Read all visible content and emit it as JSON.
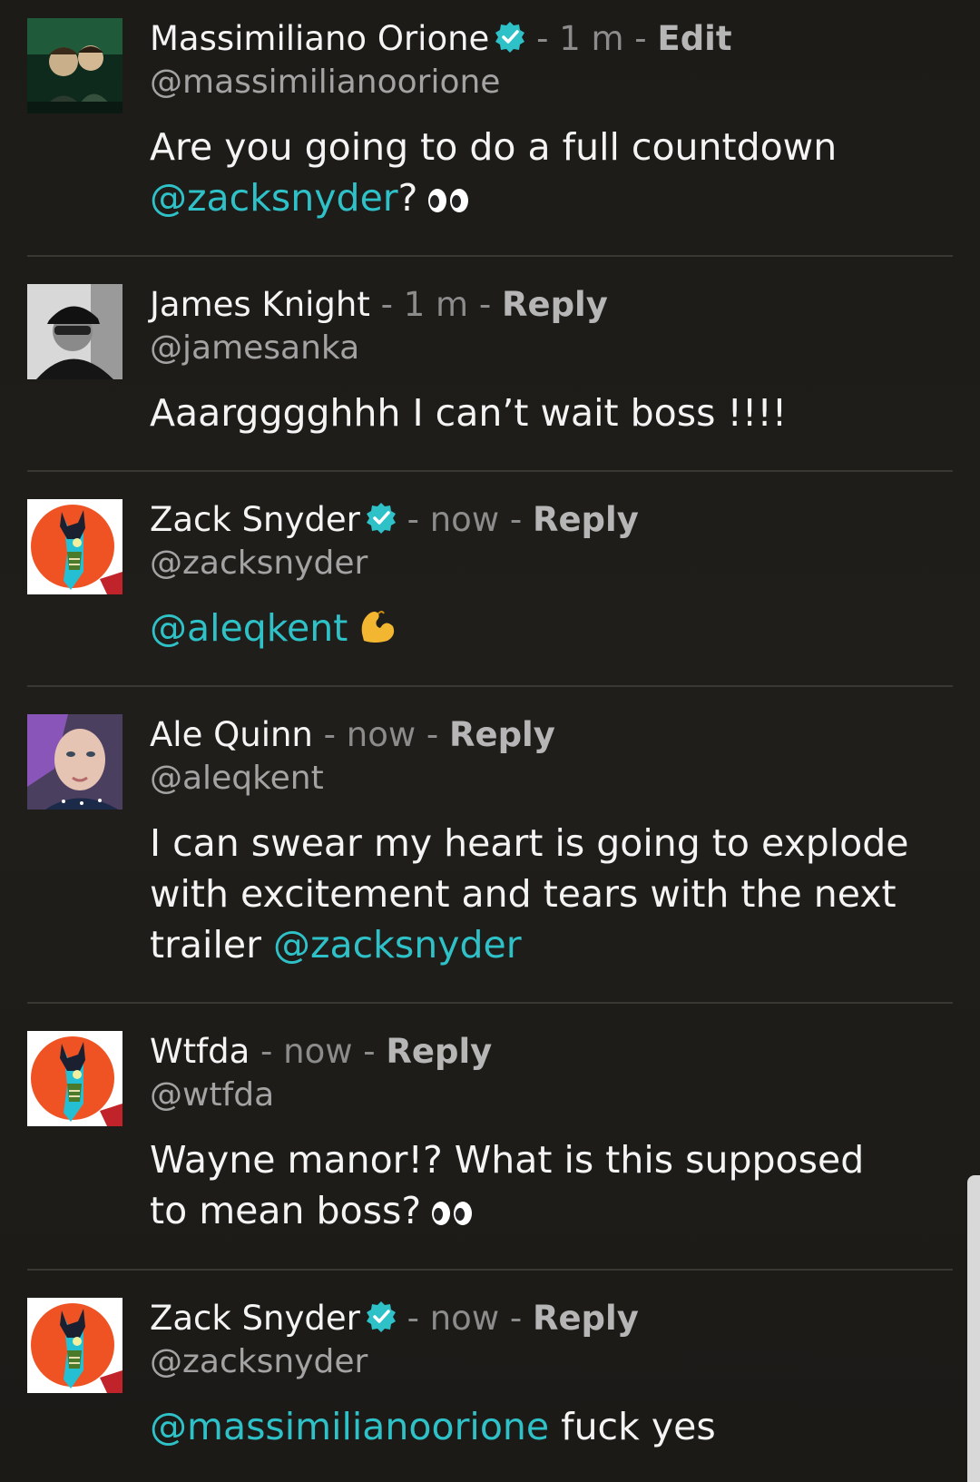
{
  "comments": [
    {
      "name": "Massimiliano Orione",
      "verified": true,
      "sep1": " - ",
      "time": "1 m",
      "sep2": " - ",
      "action": "Edit",
      "handle": "@massimilianoorione",
      "text_before": "Are you going to do a full countdown ",
      "mention": "@zacksnyder",
      "text_after": "?",
      "emoji": "eyes-emoji",
      "avatar": "photo-two-people-green"
    },
    {
      "name": "James Knight",
      "verified": false,
      "sep1": " - ",
      "time": "1 m",
      "sep2": " - ",
      "action": "Reply",
      "handle": "@jamesanka",
      "text_before": "Aaargggghhh I can’t wait boss !!!!",
      "avatar": "photo-man-cap-bw"
    },
    {
      "name": "Zack Snyder",
      "verified": true,
      "sep1": " - ",
      "time": "now",
      "sep2": " - ",
      "action": "Reply",
      "handle": "@zacksnyder",
      "mention": "@aleqkent",
      "emoji": "flexed-biceps-emoji",
      "avatar": "batman-zombie-illustration"
    },
    {
      "name": "Ale Quinn",
      "verified": false,
      "sep1": " - ",
      "time": "now",
      "sep2": " - ",
      "action": "Reply",
      "handle": "@aleqkent",
      "text_line1": "I can swear my heart is going to explode",
      "text_line2": "with excitement and tears with the next",
      "text_line3": "trailer ",
      "mention": "@zacksnyder",
      "avatar": "photo-woman-purple-hair"
    },
    {
      "name": "Wtfda",
      "verified": false,
      "sep1": " - ",
      "time": "now",
      "sep2": " - ",
      "action": "Reply",
      "handle": "@wtfda",
      "text_line1": "Wayne manor!? What is this supposed",
      "text_line2": "to mean boss?",
      "emoji": "eyes-emoji",
      "avatar": "batman-zombie-illustration"
    },
    {
      "name": "Zack Snyder",
      "verified": true,
      "sep1": " - ",
      "time": "now",
      "sep2": " - ",
      "action": "Reply",
      "handle": "@zacksnyder",
      "mention": "@massimilianoorione",
      "text_after": " fuck yes",
      "avatar": "batman-zombie-illustration"
    }
  ],
  "colors": {
    "background": "#1e1c19",
    "mention": "#2fc1c8",
    "verified": "#2fc1c8",
    "meta": "#8c8c8c",
    "divider": "#3a3833"
  }
}
